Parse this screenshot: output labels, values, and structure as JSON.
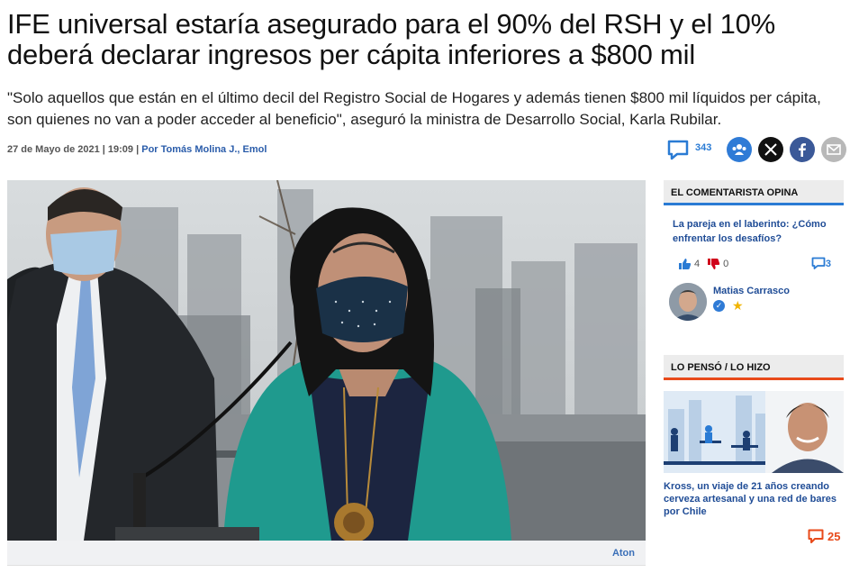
{
  "article": {
    "headline": "IFE universal estaría asegurado para el 90% del RSH y el 10% deberá declarar ingresos per cápita inferiores a $800 mil",
    "subhead": "\"Solo aquellos que están en el último decil del Registro Social de Hogares y además tienen $800 mil líquidos per cápita, son quienes no van a poder acceder al beneficio\", aseguró la ministra de Desarrollo Social, Karla Rubilar.",
    "date": "27 de Mayo de 2021 | 19:09 | ",
    "author": "Por Tomás Molina J., Emol",
    "comments_count": "343",
    "photo_credit": "Aton"
  },
  "share": {
    "icons": [
      "comment-icon",
      "community-icon",
      "x-icon",
      "facebook-icon",
      "mail-icon"
    ]
  },
  "sidebar": {
    "opina": {
      "header": "EL COMENTARISTA OPINA",
      "title": "La pareja en el laberinto: ¿Cómo enfrentar los desafíos?",
      "likes": "4",
      "dislikes": "0",
      "comments": "3",
      "author": "Matias Carrasco"
    },
    "penso": {
      "header": "LO PENSÓ / LO HIZO",
      "title": "Kross, un viaje de 21 años creando cerveza artesanal y una red de bares por Chile",
      "comments": "25"
    }
  },
  "colors": {
    "link_blue": "#1f4c96",
    "accent_blue": "#2a7bd4",
    "accent_orange": "#e84a1a",
    "facebook": "#3b5998"
  }
}
